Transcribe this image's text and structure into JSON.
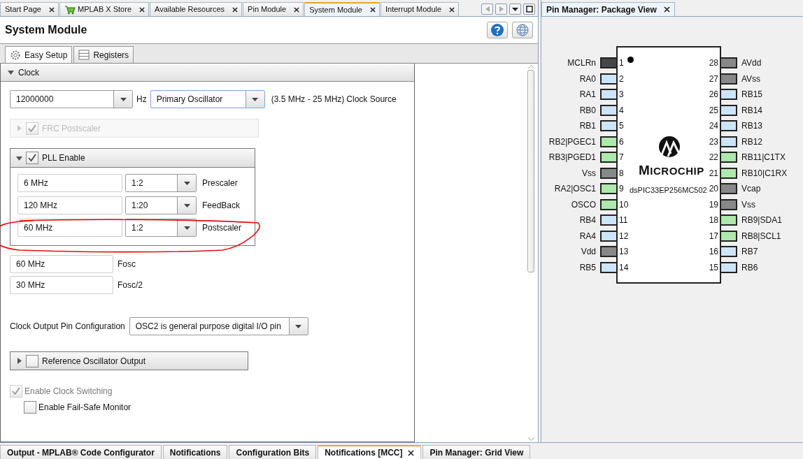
{
  "editor_tabs": [
    {
      "label": "Start Page",
      "selected": false,
      "kind": "page"
    },
    {
      "label": "MPLAB X Store",
      "selected": false,
      "kind": "store"
    },
    {
      "label": "Available Resources",
      "selected": false,
      "kind": "page"
    },
    {
      "label": "Pin Module",
      "selected": false,
      "kind": "page"
    },
    {
      "label": "System Module",
      "selected": true,
      "kind": "page"
    },
    {
      "label": "Interrupt Module",
      "selected": false,
      "kind": "page"
    }
  ],
  "module": {
    "title": "System Module"
  },
  "sub_tabs": [
    {
      "label": "Easy Setup",
      "selected": true,
      "kind": "setup"
    },
    {
      "label": "Registers",
      "selected": false,
      "kind": "registers"
    }
  ],
  "section": {
    "label": "Clock",
    "expanded": true
  },
  "clock": {
    "frequency": "12000000",
    "unit": "Hz",
    "source": "Primary Oscillator",
    "range": "(3.5 MHz - 25 MHz)",
    "source_label": "Clock Source"
  },
  "frc": {
    "label": "FRC Postscaler",
    "checked": true,
    "expanded": false,
    "disabled": true
  },
  "pll": {
    "label": "PLL Enable",
    "checked": true,
    "expanded": true,
    "rows": [
      {
        "value": "6 MHz",
        "ratio": "1:2",
        "label": "Prescaler"
      },
      {
        "value": "120 MHz",
        "ratio": "1:20",
        "label": "FeedBack"
      },
      {
        "value": "60 MHz",
        "ratio": "1:2",
        "label": "Postscaler"
      }
    ]
  },
  "outputs": [
    {
      "value": "60 MHz",
      "label": "Fosc"
    },
    {
      "value": "30 MHz",
      "label": "Fosc/2"
    }
  ],
  "clock_output": {
    "label": "Clock Output Pin Configuration",
    "value": "OSC2 is general purpose digital I/O pin"
  },
  "reference": {
    "label": "Reference Oscillator Output",
    "checked": false,
    "expanded": false
  },
  "options": [
    {
      "label": "Enable Clock Switching",
      "checked": true,
      "disabled": true,
      "children": [
        {
          "label": "Enable Fail-Safe Monitor",
          "checked": false,
          "disabled": false
        }
      ]
    }
  ],
  "bottom_tabs": [
    {
      "label": "Output - MPLAB® Code Configurator",
      "selected": false,
      "closable": false
    },
    {
      "label": "Notifications",
      "selected": false,
      "closable": false
    },
    {
      "label": "Configuration Bits",
      "selected": false,
      "closable": false
    },
    {
      "label": "Notifications [MCC]",
      "selected": true,
      "closable": true
    },
    {
      "label": "Pin Manager: Grid View",
      "selected": false,
      "closable": false
    }
  ],
  "package_view": {
    "tab": "Pin Manager: Package View",
    "logo": "MICROCHIP",
    "device": "dsPIC33EP256MC502",
    "left_pins": [
      {
        "number": "1",
        "name": "MCLRn",
        "color": "#464646"
      },
      {
        "number": "2",
        "name": "RA0",
        "color": "#cce5fb"
      },
      {
        "number": "3",
        "name": "RA1",
        "color": "#cce5fb"
      },
      {
        "number": "4",
        "name": "RB0",
        "color": "#cce5fb"
      },
      {
        "number": "5",
        "name": "RB1",
        "color": "#cce5fb"
      },
      {
        "number": "6",
        "name": "RB2|PGEC1",
        "color": "#aee8aa"
      },
      {
        "number": "7",
        "name": "RB3|PGED1",
        "color": "#aee8aa"
      },
      {
        "number": "8",
        "name": "Vss",
        "color": "#888888"
      },
      {
        "number": "9",
        "name": "RA2|OSC1",
        "color": "#aee8aa"
      },
      {
        "number": "10",
        "name": "OSCO",
        "color": "#aee8aa"
      },
      {
        "number": "11",
        "name": "RB4",
        "color": "#cce5fb"
      },
      {
        "number": "12",
        "name": "RA4",
        "color": "#cce5fb"
      },
      {
        "number": "13",
        "name": "Vdd",
        "color": "#888888"
      },
      {
        "number": "14",
        "name": "RB5",
        "color": "#cce5fb"
      }
    ],
    "right_pins": [
      {
        "number": "28",
        "name": "AVdd",
        "color": "#888888"
      },
      {
        "number": "27",
        "name": "AVss",
        "color": "#888888"
      },
      {
        "number": "26",
        "name": "RB15",
        "color": "#cce5fb"
      },
      {
        "number": "25",
        "name": "RB14",
        "color": "#cce5fb"
      },
      {
        "number": "24",
        "name": "RB13",
        "color": "#cce5fb"
      },
      {
        "number": "23",
        "name": "RB12",
        "color": "#cce5fb"
      },
      {
        "number": "22",
        "name": "RB11|C1TX",
        "color": "#aee8aa"
      },
      {
        "number": "21",
        "name": "RB10|C1RX",
        "color": "#aee8aa"
      },
      {
        "number": "20",
        "name": "Vcap",
        "color": "#888888"
      },
      {
        "number": "19",
        "name": "Vss",
        "color": "#888888"
      },
      {
        "number": "18",
        "name": "RB9|SDA1",
        "color": "#aee8aa"
      },
      {
        "number": "17",
        "name": "RB8|SCL1",
        "color": "#aee8aa"
      },
      {
        "number": "16",
        "name": "RB7",
        "color": "#cce5fb"
      },
      {
        "number": "15",
        "name": "RB6",
        "color": "#cce5fb"
      }
    ]
  }
}
